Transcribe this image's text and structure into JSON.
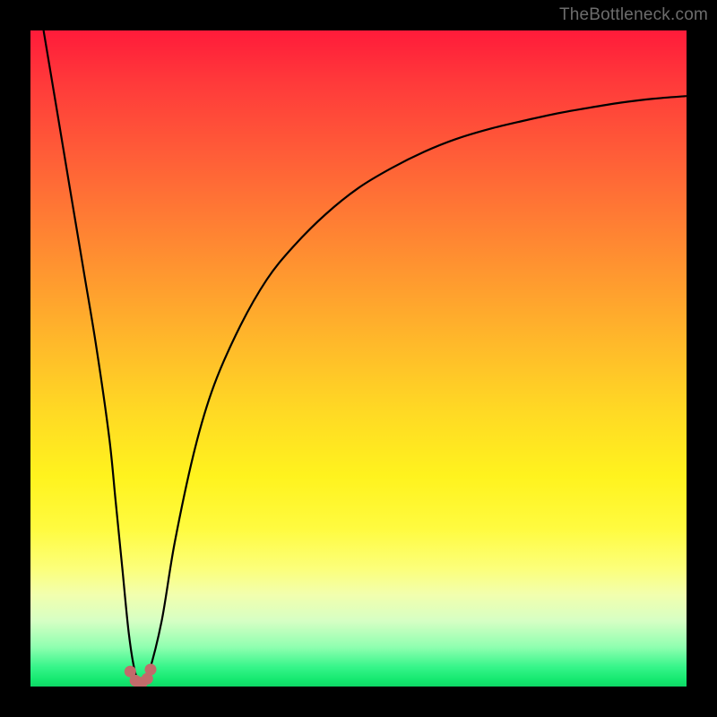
{
  "watermark": "TheBottleneck.com",
  "colors": {
    "frame": "#000000",
    "curve": "#000000",
    "marker": "#c26b6b",
    "watermark": "#6c6c6c"
  },
  "chart_data": {
    "type": "line",
    "title": "",
    "xlabel": "",
    "ylabel": "",
    "xlim": [
      0,
      100
    ],
    "ylim": [
      0,
      100
    ],
    "grid": false,
    "series": [
      {
        "name": "bottleneck-curve",
        "x": [
          2,
          4,
          6,
          8,
          10,
          12,
          13,
          14,
          15,
          16,
          17,
          18,
          20,
          22,
          25,
          28,
          32,
          36,
          40,
          45,
          50,
          55,
          60,
          65,
          70,
          75,
          80,
          85,
          90,
          95,
          100
        ],
        "values": [
          100,
          88,
          76,
          64,
          52,
          38,
          28,
          18,
          8,
          2,
          0.5,
          2,
          10,
          22,
          36,
          46,
          55,
          62,
          67,
          72,
          76,
          79,
          81.5,
          83.5,
          85,
          86.2,
          87.3,
          88.2,
          89,
          89.6,
          90
        ]
      }
    ],
    "markers": {
      "name": "minimum-markers",
      "x": [
        15.2,
        16.0,
        16.5,
        17.0,
        17.8,
        18.3
      ],
      "values": [
        2.3,
        0.9,
        0.6,
        0.6,
        1.2,
        2.6
      ]
    },
    "background_gradient": {
      "top": "#ff1b3a",
      "mid": "#fff31e",
      "bottom": "#0ed765"
    }
  }
}
